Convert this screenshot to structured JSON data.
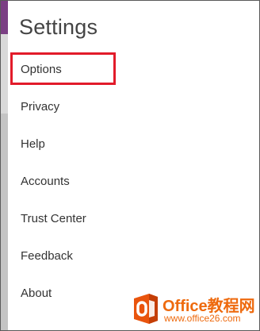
{
  "header": {
    "title": "Settings"
  },
  "menu": [
    {
      "label": "Options"
    },
    {
      "label": "Privacy"
    },
    {
      "label": "Help"
    },
    {
      "label": "Accounts"
    },
    {
      "label": "Trust Center"
    },
    {
      "label": "Feedback"
    },
    {
      "label": "About"
    }
  ],
  "watermark": {
    "brand": "Office教程网",
    "url": "www.office26.com"
  },
  "colors": {
    "accent": "#7b3f84",
    "highlight": "#e21b2a",
    "watermark": "#ee6a0e"
  }
}
